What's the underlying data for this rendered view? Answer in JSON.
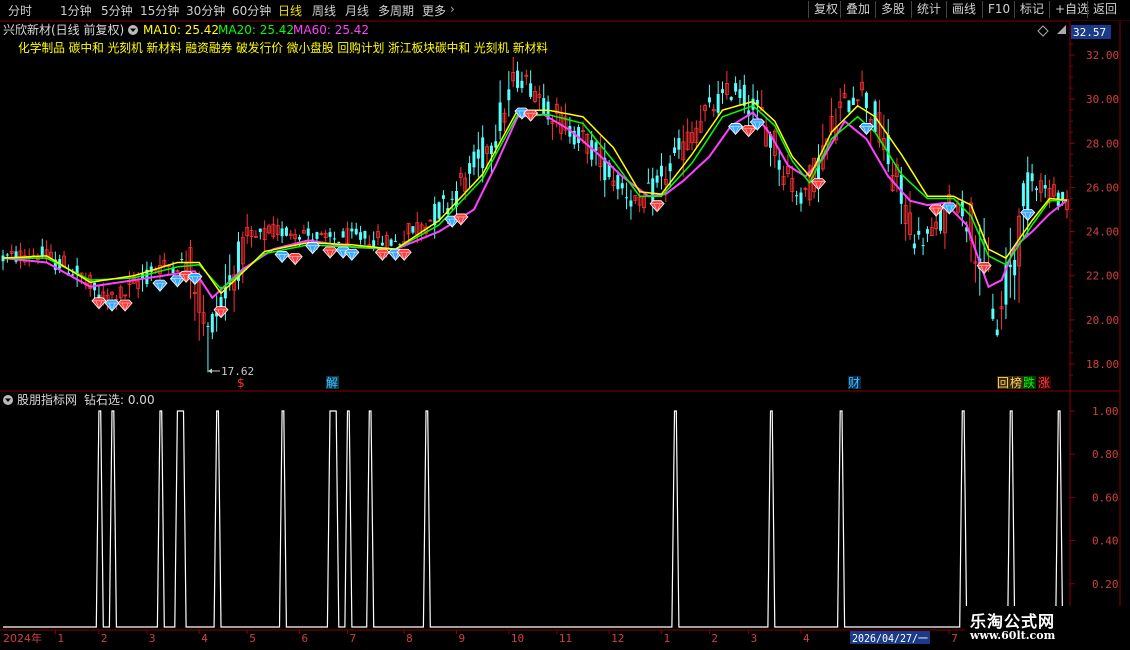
{
  "toolbar": {
    "periods": [
      {
        "label": "分时",
        "active": false
      },
      {
        "label": "1分钟",
        "active": false
      },
      {
        "label": "5分钟",
        "active": false
      },
      {
        "label": "15分钟",
        "active": false
      },
      {
        "label": "30分钟",
        "active": false
      },
      {
        "label": "60分钟",
        "active": false
      },
      {
        "label": "日线",
        "active": true
      },
      {
        "label": "周线",
        "active": false
      },
      {
        "label": "月线",
        "active": false
      },
      {
        "label": "多周期",
        "active": false
      },
      {
        "label": "更多",
        "active": false
      }
    ],
    "buttons": [
      "复权",
      "叠加",
      "多股",
      "统计",
      "画线",
      "F10",
      "标记",
      "+自选",
      "返回"
    ]
  },
  "main_panel": {
    "stock_title": "兴欣新材(日线 前复权)",
    "ma_labels": [
      {
        "text": "MA10: 25.42",
        "color": "#ffff00"
      },
      {
        "text": "MA20: 25.42",
        "color": "#00ff00"
      },
      {
        "text": "MA60: 25.42",
        "color": "#ff40ff"
      }
    ],
    "concepts": "化学制品 碳中和 光刻机 新材料 融资融券 破发行价 微小盘股 回购计划 浙江板块碳中和 光刻机 新材料",
    "current_price": "32.57",
    "low_marker": "17.62",
    "event_markers": [
      {
        "label": "$",
        "color": "#ff3030"
      },
      {
        "label": "解",
        "color": "#40c0ff"
      },
      {
        "label": "财",
        "color": "#40c0ff"
      }
    ],
    "tag_buttons": [
      {
        "label": "回",
        "color": "#ffd070"
      },
      {
        "label": "榜",
        "color": "#ffd070"
      },
      {
        "label": "跌",
        "color": "#00ff00"
      },
      {
        "label": "涨",
        "color": "#ff4040"
      }
    ]
  },
  "sub_panel": {
    "indicator_label": "股朋指标网",
    "value_label": "钻石选: 0.00",
    "signal_days": [
      22,
      25,
      36,
      40,
      41,
      49,
      64,
      75,
      76,
      79,
      84,
      97,
      154,
      176,
      192,
      220,
      231,
      242
    ]
  },
  "x_axis": {
    "year_label": "2024年",
    "months": [
      {
        "label": "1",
        "day": 12
      },
      {
        "label": "2",
        "day": 22
      },
      {
        "label": "3",
        "day": 33
      },
      {
        "label": "4",
        "day": 45
      },
      {
        "label": "5",
        "day": 56
      },
      {
        "label": "6",
        "day": 68
      },
      {
        "label": "7",
        "day": 79
      },
      {
        "label": "8",
        "day": 92
      },
      {
        "label": "9",
        "day": 104
      },
      {
        "label": "10",
        "day": 116
      },
      {
        "label": "11",
        "day": 127
      },
      {
        "label": "12",
        "day": 139
      },
      {
        "label": "1",
        "day": 151
      },
      {
        "label": "2",
        "day": 162
      },
      {
        "label": "3",
        "day": 171
      },
      {
        "label": "4",
        "day": 183
      },
      {
        "label": "7",
        "day": 217
      }
    ],
    "date_box": "2026/04/27/一"
  },
  "watermark": {
    "title": "乐淘公式网",
    "url": "www.60lt.com"
  },
  "chart_data": [
    {
      "type": "candlestick",
      "title": "兴欣新材(日线 前复权)",
      "ylim": [
        17,
        33
      ],
      "y_ticks": [
        18.0,
        20.0,
        22.0,
        24.0,
        26.0,
        28.0,
        30.0,
        32.0
      ],
      "price_points": [
        [
          0,
          22.8
        ],
        [
          8,
          23.0
        ],
        [
          16,
          22.3
        ],
        [
          22,
          21.0
        ],
        [
          28,
          21.2
        ],
        [
          35,
          22.4
        ],
        [
          43,
          22.6
        ],
        [
          47,
          19.5
        ],
        [
          52,
          21.8
        ],
        [
          56,
          23.5
        ],
        [
          62,
          24.0
        ],
        [
          68,
          24.0
        ],
        [
          74,
          23.6
        ],
        [
          80,
          23.8
        ],
        [
          90,
          23.5
        ],
        [
          98,
          24.6
        ],
        [
          103,
          25.5
        ],
        [
          110,
          27.5
        ],
        [
          115,
          29.5
        ],
        [
          118,
          31.0
        ],
        [
          122,
          30.5
        ],
        [
          128,
          29.0
        ],
        [
          134,
          28.0
        ],
        [
          140,
          26.5
        ],
        [
          146,
          25.2
        ],
        [
          150,
          26.0
        ],
        [
          156,
          27.8
        ],
        [
          162,
          29.5
        ],
        [
          168,
          30.5
        ],
        [
          174,
          29.2
        ],
        [
          179,
          27.0
        ],
        [
          183,
          25.5
        ],
        [
          187,
          27.0
        ],
        [
          192,
          29.5
        ],
        [
          197,
          30.5
        ],
        [
          201,
          28.5
        ],
        [
          206,
          25.5
        ],
        [
          210,
          23.5
        ],
        [
          214,
          24.0
        ],
        [
          218,
          25.5
        ],
        [
          222,
          24.5
        ],
        [
          226,
          21.5
        ],
        [
          228,
          19.5
        ],
        [
          232,
          23.0
        ],
        [
          236,
          26.5
        ],
        [
          240,
          25.8
        ],
        [
          244,
          25.4
        ]
      ],
      "ma10": [
        [
          0,
          22.8
        ],
        [
          10,
          22.9
        ],
        [
          20,
          21.7
        ],
        [
          30,
          22.0
        ],
        [
          40,
          22.6
        ],
        [
          45,
          22.6
        ],
        [
          50,
          21.2
        ],
        [
          60,
          23.1
        ],
        [
          70,
          23.5
        ],
        [
          80,
          23.4
        ],
        [
          90,
          23.2
        ],
        [
          100,
          24.5
        ],
        [
          110,
          26.6
        ],
        [
          118,
          29.5
        ],
        [
          125,
          29.5
        ],
        [
          133,
          29.2
        ],
        [
          140,
          27.8
        ],
        [
          146,
          25.8
        ],
        [
          151,
          25.7
        ],
        [
          158,
          27.5
        ],
        [
          165,
          29.5
        ],
        [
          172,
          29.9
        ],
        [
          177,
          29.0
        ],
        [
          181,
          27.4
        ],
        [
          185,
          26.5
        ],
        [
          190,
          28.5
        ],
        [
          196,
          29.7
        ],
        [
          200,
          29.2
        ],
        [
          206,
          27.5
        ],
        [
          212,
          25.6
        ],
        [
          218,
          25.6
        ],
        [
          222,
          25.2
        ],
        [
          226,
          23.2
        ],
        [
          230,
          22.8
        ],
        [
          236,
          24.5
        ],
        [
          240,
          25.5
        ],
        [
          244,
          25.42
        ]
      ],
      "ma20": [
        [
          0,
          22.8
        ],
        [
          10,
          22.8
        ],
        [
          20,
          21.8
        ],
        [
          30,
          21.9
        ],
        [
          40,
          22.4
        ],
        [
          45,
          22.5
        ],
        [
          50,
          21.4
        ],
        [
          60,
          23.0
        ],
        [
          70,
          23.4
        ],
        [
          80,
          23.3
        ],
        [
          90,
          23.2
        ],
        [
          100,
          24.3
        ],
        [
          110,
          26.4
        ],
        [
          118,
          29.3
        ],
        [
          125,
          29.3
        ],
        [
          133,
          28.9
        ],
        [
          140,
          27.2
        ],
        [
          146,
          25.6
        ],
        [
          151,
          25.6
        ],
        [
          158,
          27.1
        ],
        [
          165,
          29.2
        ],
        [
          172,
          29.7
        ],
        [
          177,
          28.8
        ],
        [
          181,
          27.2
        ],
        [
          185,
          26.2
        ],
        [
          190,
          28.2
        ],
        [
          196,
          29.2
        ],
        [
          200,
          28.5
        ],
        [
          206,
          26.6
        ],
        [
          212,
          25.5
        ],
        [
          218,
          25.5
        ],
        [
          222,
          24.7
        ],
        [
          226,
          22.9
        ],
        [
          230,
          22.5
        ],
        [
          236,
          24.3
        ],
        [
          240,
          25.4
        ],
        [
          244,
          25.42
        ]
      ],
      "ma60": [
        [
          0,
          22.8
        ],
        [
          10,
          22.6
        ],
        [
          20,
          21.5
        ],
        [
          30,
          21.8
        ],
        [
          40,
          22.1
        ],
        [
          44,
          22.2
        ],
        [
          48,
          21.0
        ],
        [
          55,
          22.3
        ],
        [
          62,
          23.2
        ],
        [
          70,
          23.6
        ],
        [
          80,
          23.3
        ],
        [
          90,
          23.2
        ],
        [
          100,
          24.0
        ],
        [
          108,
          25.0
        ],
        [
          113,
          27.0
        ],
        [
          118,
          29.2
        ],
        [
          124,
          29.3
        ],
        [
          130,
          28.6
        ],
        [
          136,
          27.6
        ],
        [
          142,
          26.5
        ],
        [
          148,
          25.6
        ],
        [
          152,
          25.7
        ],
        [
          156,
          26.3
        ],
        [
          162,
          27.4
        ],
        [
          167,
          28.8
        ],
        [
          172,
          29.4
        ],
        [
          176,
          28.4
        ],
        [
          180,
          27.0
        ],
        [
          184,
          26.5
        ],
        [
          188,
          27.3
        ],
        [
          193,
          29.0
        ],
        [
          198,
          28.2
        ],
        [
          203,
          26.5
        ],
        [
          208,
          25.4
        ],
        [
          212,
          25.2
        ],
        [
          216,
          25.3
        ],
        [
          221,
          24.3
        ],
        [
          224,
          22.6
        ],
        [
          226,
          21.5
        ],
        [
          229,
          21.8
        ],
        [
          232,
          23.3
        ],
        [
          236,
          24.0
        ],
        [
          240,
          24.8
        ],
        [
          244,
          25.42
        ]
      ],
      "diamonds": [
        {
          "day": 22,
          "price": 21.0,
          "color": "red"
        },
        {
          "day": 25,
          "price": 20.9,
          "color": "blue"
        },
        {
          "day": 28,
          "price": 20.9,
          "color": "red"
        },
        {
          "day": 36,
          "price": 21.8,
          "color": "blue"
        },
        {
          "day": 40,
          "price": 22.0,
          "color": "blue"
        },
        {
          "day": 42,
          "price": 22.2,
          "color": "red"
        },
        {
          "day": 44,
          "price": 22.1,
          "color": "blue"
        },
        {
          "day": 50,
          "price": 20.6,
          "color": "red"
        },
        {
          "day": 64,
          "price": 23.1,
          "color": "blue"
        },
        {
          "day": 67,
          "price": 23.0,
          "color": "red"
        },
        {
          "day": 71,
          "price": 23.5,
          "color": "blue"
        },
        {
          "day": 75,
          "price": 23.3,
          "color": "red"
        },
        {
          "day": 78,
          "price": 23.3,
          "color": "blue"
        },
        {
          "day": 80,
          "price": 23.2,
          "color": "blue"
        },
        {
          "day": 87,
          "price": 23.2,
          "color": "red"
        },
        {
          "day": 90,
          "price": 23.2,
          "color": "blue"
        },
        {
          "day": 92,
          "price": 23.2,
          "color": "red"
        },
        {
          "day": 103,
          "price": 24.7,
          "color": "blue"
        },
        {
          "day": 105,
          "price": 24.8,
          "color": "red"
        },
        {
          "day": 119,
          "price": 29.6,
          "color": "blue"
        },
        {
          "day": 121,
          "price": 29.5,
          "color": "red"
        },
        {
          "day": 150,
          "price": 25.4,
          "color": "red"
        },
        {
          "day": 168,
          "price": 28.9,
          "color": "blue"
        },
        {
          "day": 171,
          "price": 28.8,
          "color": "red"
        },
        {
          "day": 173,
          "price": 29.1,
          "color": "blue"
        },
        {
          "day": 187,
          "price": 26.4,
          "color": "red"
        },
        {
          "day": 198,
          "price": 28.9,
          "color": "blue"
        },
        {
          "day": 214,
          "price": 25.2,
          "color": "red"
        },
        {
          "day": 217,
          "price": 25.3,
          "color": "blue"
        },
        {
          "day": 225,
          "price": 22.6,
          "color": "red"
        },
        {
          "day": 235,
          "price": 25.0,
          "color": "blue"
        }
      ]
    },
    {
      "type": "line",
      "title": "钻石选",
      "ylim": [
        0,
        1.05
      ],
      "y_ticks": [
        0.2,
        0.4,
        0.6,
        0.8,
        1.0
      ],
      "series": [
        {
          "name": "钻石选",
          "values": "pulse to 1.00 on signal_days, otherwise 0.00"
        }
      ]
    }
  ]
}
